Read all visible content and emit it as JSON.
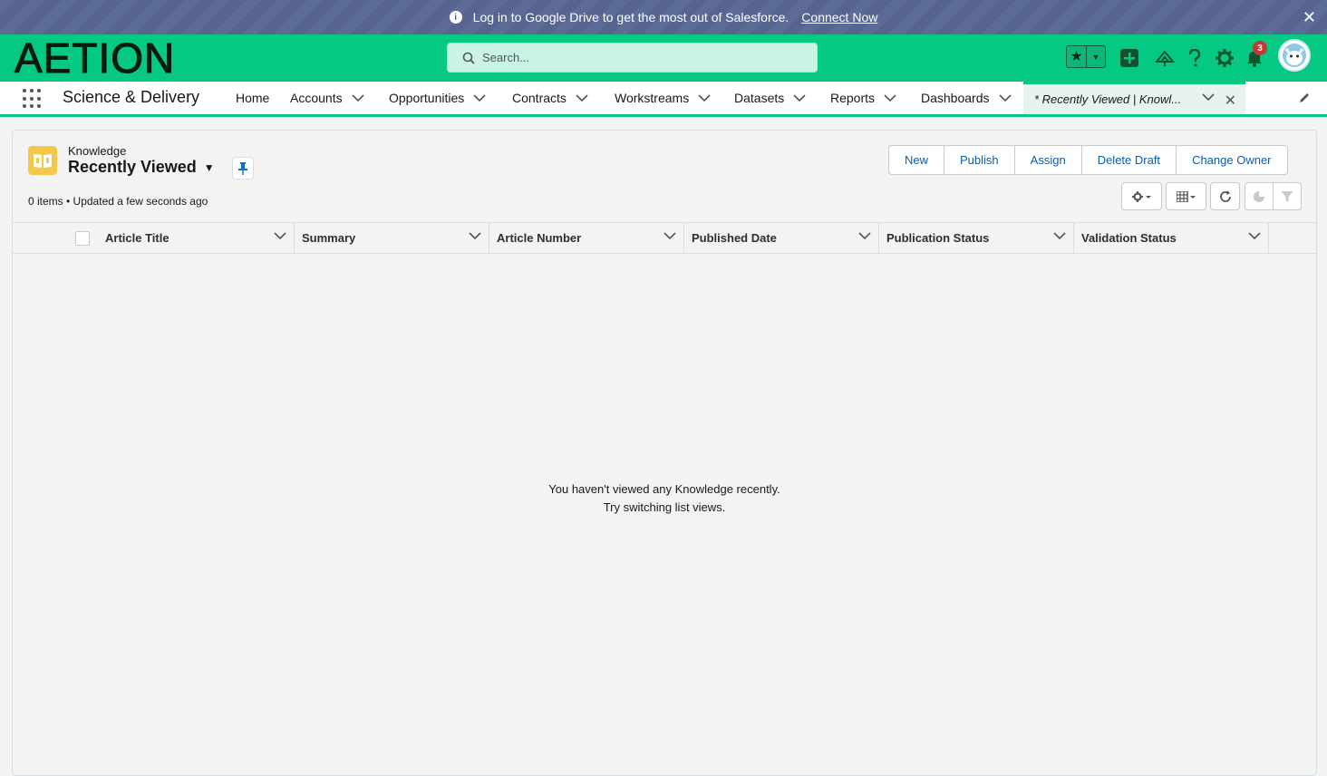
{
  "banner": {
    "message": "Log in to Google Drive to get the most out of Salesforce.",
    "link": "Connect Now",
    "close": "✕"
  },
  "header": {
    "logo": "AETION",
    "search_placeholder": "Search...",
    "notification_count": "3"
  },
  "nav": {
    "app_name": "Science & Delivery",
    "items": [
      {
        "label": "Home"
      },
      {
        "label": "Accounts"
      },
      {
        "label": "Opportunities"
      },
      {
        "label": "Contracts"
      },
      {
        "label": "Workstreams"
      },
      {
        "label": "Datasets"
      },
      {
        "label": "Reports"
      },
      {
        "label": "Dashboards"
      }
    ],
    "active_tab": "* Recently Viewed | Knowl..."
  },
  "list": {
    "object_label": "Knowledge",
    "view_name": "Recently Viewed",
    "meta": "0 items • Updated a few seconds ago",
    "buttons": [
      "New",
      "Publish",
      "Assign",
      "Delete Draft",
      "Change Owner"
    ],
    "columns": [
      "Article Title",
      "Summary",
      "Article Number",
      "Published Date",
      "Publication Status",
      "Validation Status"
    ],
    "empty_line1": "You haven't viewed any Knowledge recently.",
    "empty_line2": "Try switching list views."
  },
  "colors": {
    "header_green": "#05c982",
    "banner_blue": "#56648f",
    "link_blue": "#0b5cab"
  }
}
